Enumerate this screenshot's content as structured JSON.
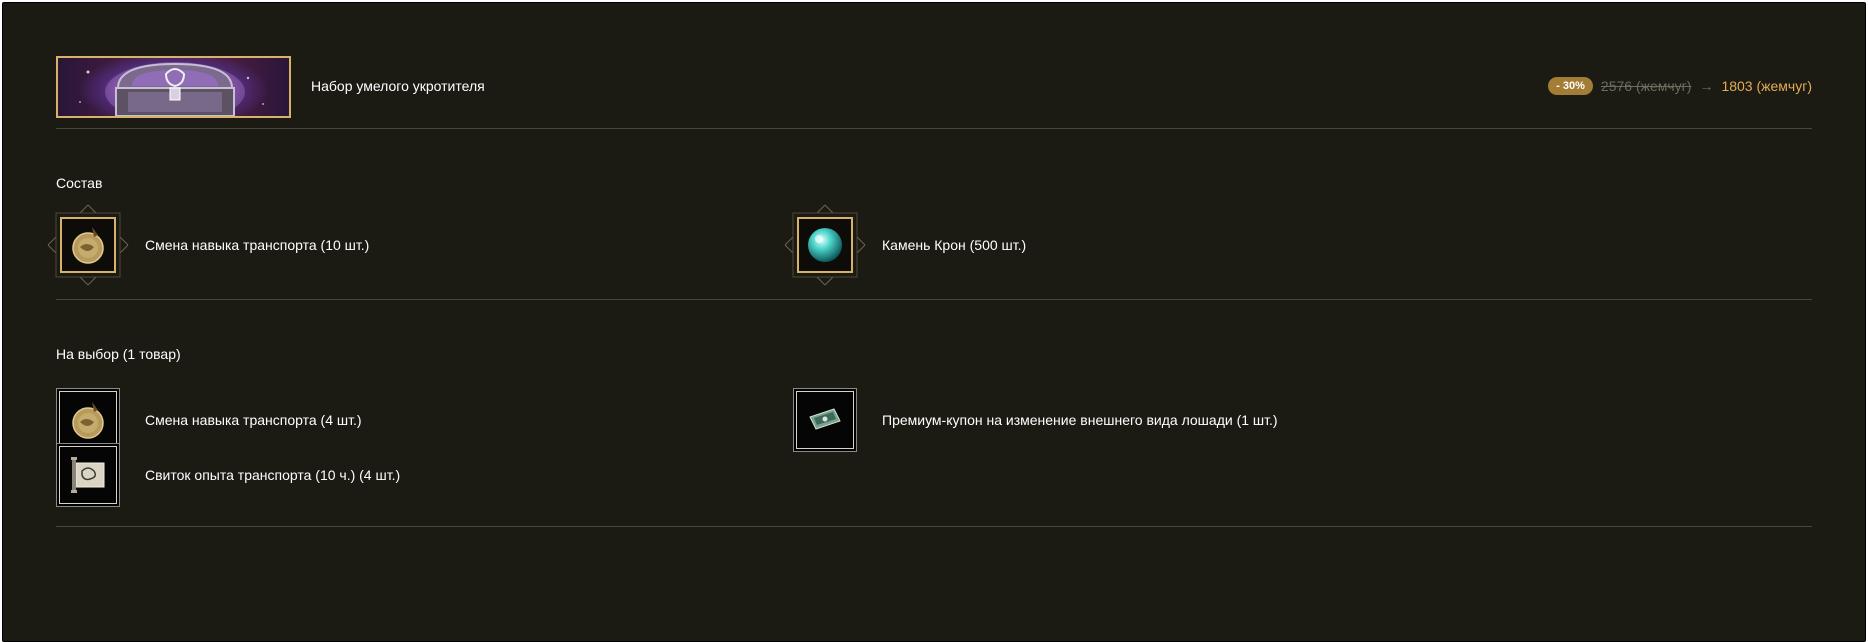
{
  "set": {
    "title": "Набор умелого укротителя",
    "banner_icon": "treasure-chest-icon",
    "discount_badge": "- 30%",
    "old_price": "2576 (жемчуг)",
    "arrow": "→",
    "new_price": "1803 (жемчуг)"
  },
  "composition": {
    "label": "Состав",
    "items": [
      {
        "name": "Смена навыка транспорта (10 шт.)",
        "icon": "transport-skill-pouch-icon"
      },
      {
        "name": "Камень Крон (500 шт.)",
        "icon": "cron-stone-icon"
      }
    ]
  },
  "choice": {
    "label": "На выбор (1 товар)",
    "items": [
      {
        "name": "Смена навыка транспорта (4 шт.)",
        "icon": "transport-skill-pouch-icon"
      },
      {
        "name": "Премиум-купон на изменение внешнего вида лошади (1 шт.)",
        "icon": "premium-coupon-icon"
      },
      {
        "name": "Свиток опыта транспорта (10 ч.) (4 шт.)",
        "icon": "transport-exp-scroll-icon"
      }
    ]
  },
  "colors": {
    "background": "#1b1a13",
    "accent_gold": "#d6b26a",
    "discount_badge": "#a37d35",
    "new_price": "#e3ac56",
    "old_price": "#6f6a5c",
    "divider": "#49463c"
  }
}
